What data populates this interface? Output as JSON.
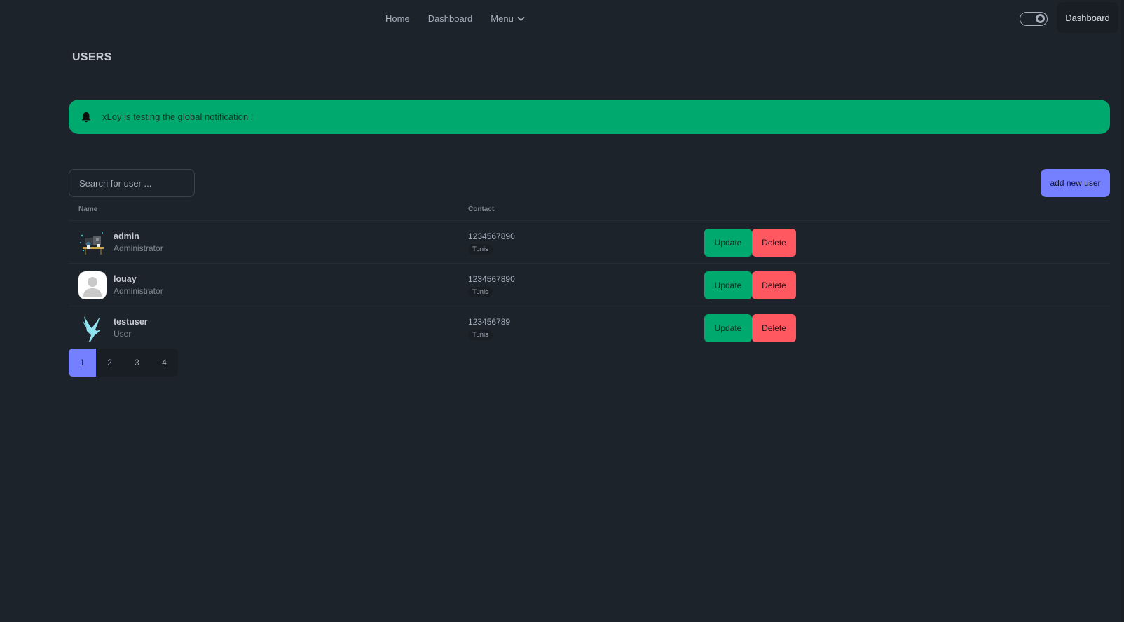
{
  "nav": {
    "links": [
      "Home",
      "Dashboard"
    ],
    "menu_label": "Menu",
    "dashboard_button": "Dashboard"
  },
  "page": {
    "title": "USERS"
  },
  "notification": {
    "text": "xLoy is testing the global notification !"
  },
  "search": {
    "placeholder": "Search for user ..."
  },
  "actions": {
    "add_user": "add new user",
    "update": "Update",
    "delete": "Delete"
  },
  "table": {
    "headers": {
      "name": "Name",
      "contact": "Contact"
    },
    "rows": [
      {
        "name": "admin",
        "role": "Administrator",
        "phone": "1234567890",
        "city": "Tunis",
        "avatar": "office-illustration-avatar"
      },
      {
        "name": "louay",
        "role": "Administrator",
        "phone": "1234567890",
        "city": "Tunis",
        "avatar": "default-user-avatar"
      },
      {
        "name": "testuser",
        "role": "User",
        "phone": "123456789",
        "city": "Tunis",
        "avatar": "bird-avatar"
      }
    ]
  },
  "pagination": {
    "pages": [
      "1",
      "2",
      "3",
      "4"
    ],
    "current": "1"
  },
  "colors": {
    "background": "#1d232a",
    "success": "#00a96e",
    "error": "#ff5861",
    "primary": "#7480ff"
  }
}
